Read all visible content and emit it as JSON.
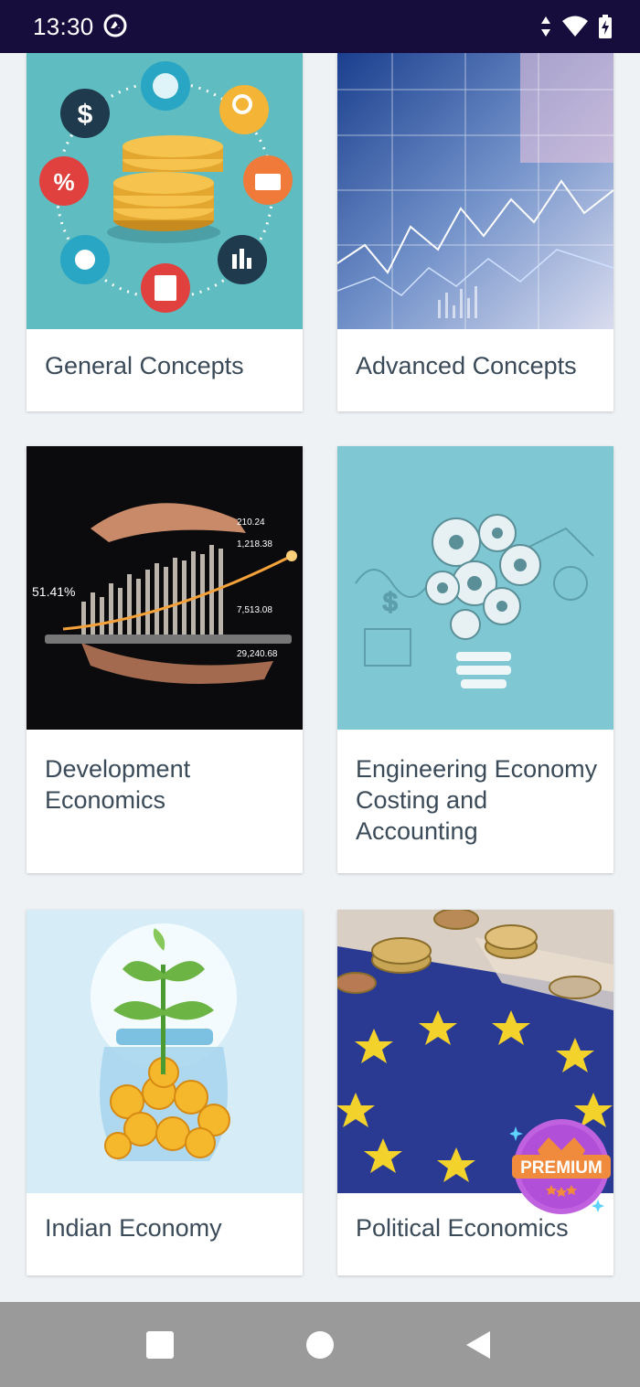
{
  "status_bar": {
    "time": "13:30",
    "icons": [
      "vpn-icon",
      "data-arrows-icon",
      "wifi-icon",
      "battery-charging-icon"
    ]
  },
  "cards": [
    {
      "label": "General Concepts",
      "image": "coins-finance-icons-illustration"
    },
    {
      "label": "Advanced Concepts",
      "image": "stock-market-data-photo"
    },
    {
      "label": "Development Economics",
      "image": "hand-over-tablet-growth-chart-photo"
    },
    {
      "label": "Engineering Economy Costing and Accounting",
      "image": "gears-lightbulb-sketch"
    },
    {
      "label": "Indian Economy",
      "image": "plant-in-jar-of-rupee-coins"
    },
    {
      "label": "Political Economics",
      "image": "euro-flag-coins-photo"
    }
  ],
  "premium_badge": {
    "label": "PREMIUM"
  },
  "nav_bar": {
    "buttons": [
      "recents-button",
      "home-button",
      "back-button"
    ]
  },
  "colors": {
    "status_bar_bg": "#170d3c",
    "page_bg": "#eef2f5",
    "card_label": "#3a4a58",
    "premium_purple": "#b24fd9",
    "premium_orange": "#f08a3c",
    "nav_bar_bg": "#9a9a9a"
  }
}
